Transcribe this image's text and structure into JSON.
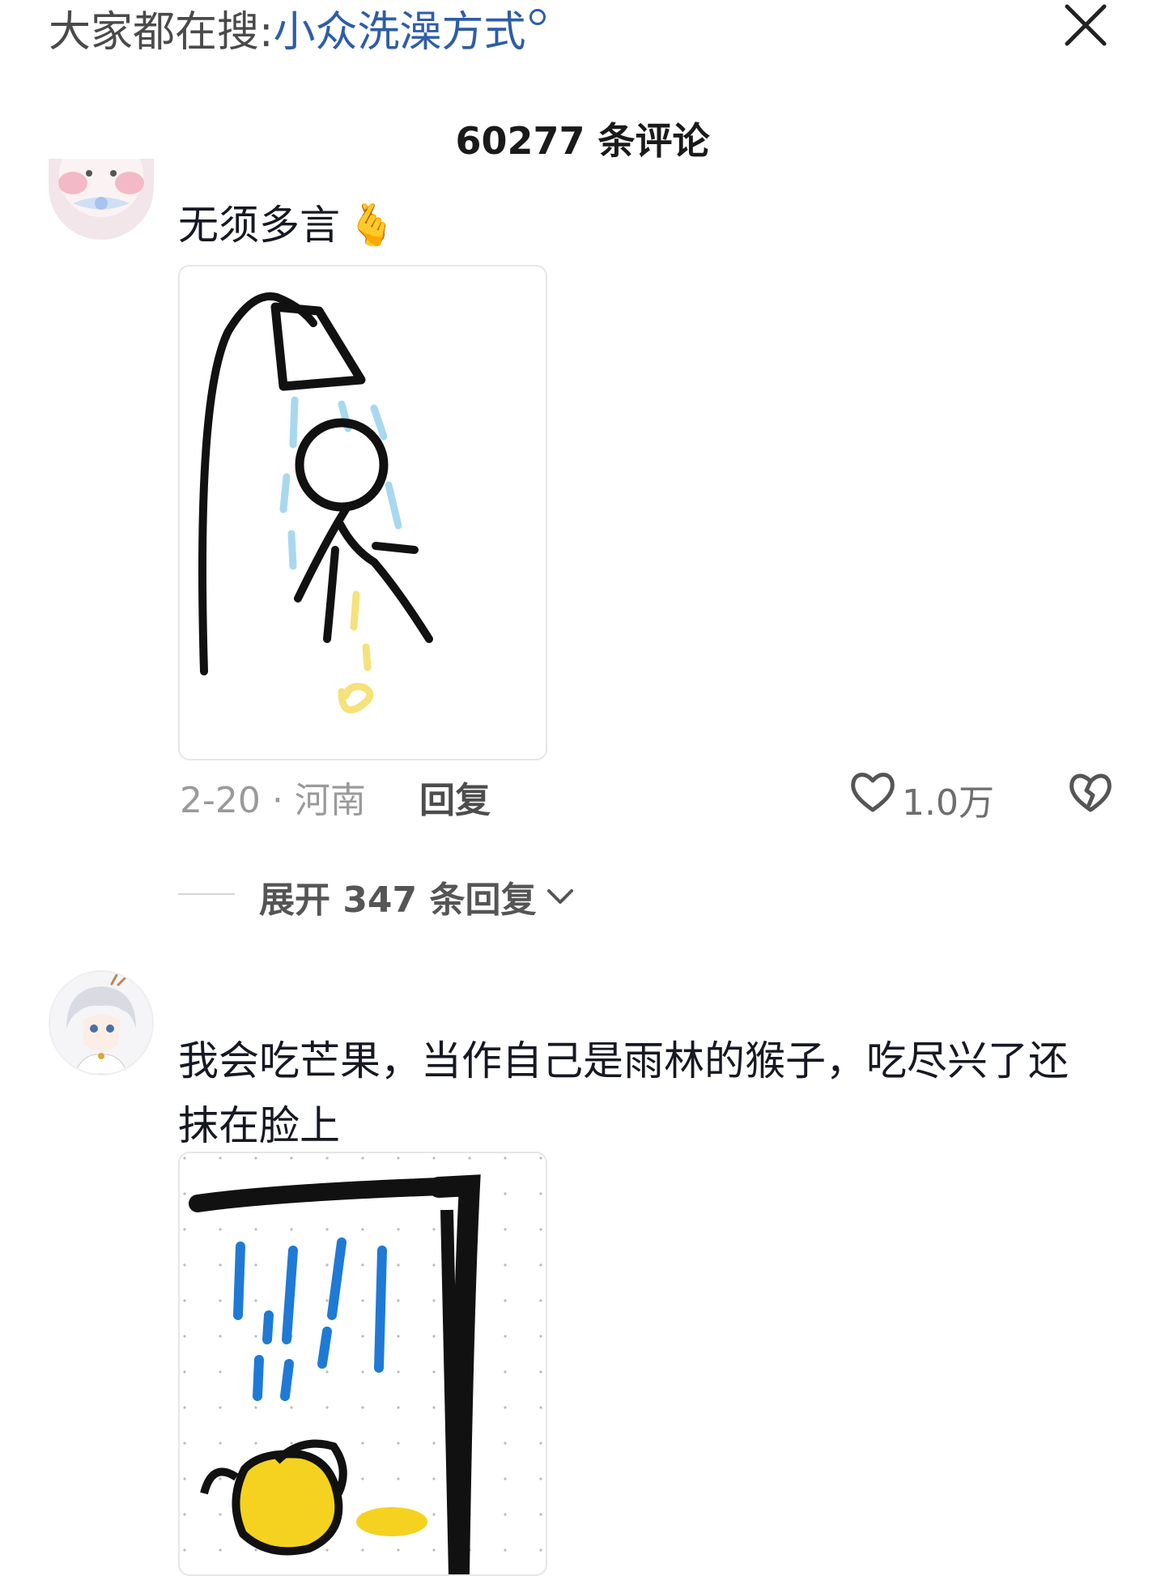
{
  "header": {
    "search_prefix": "大家都在搜:",
    "search_keyword": "小众洗澡方式",
    "search_icon": "search-icon",
    "close_icon": "close-icon"
  },
  "comments_title": "60277 条评论",
  "comments": [
    {
      "text": "无须多言",
      "emoji": "🫰",
      "image_desc_icon": "shower-drawing",
      "date_location": "2-20 · 河南",
      "reply_label": "回复",
      "like_icon": "heart-icon",
      "like_count": "1.0万",
      "dislike_icon": "broken-heart-icon",
      "expand_label": "展开 347 条回复"
    },
    {
      "text": "我会吃芒果，当作自己是雨林的猴子，吃尽兴了还抹在脸上",
      "image_desc_icon": "shower-drawing-2"
    }
  ],
  "colors": {
    "keyword": "#2e5da8",
    "text": "#161823",
    "meta": "#9a9a9a",
    "shower_water": "#a8d8f0",
    "mango": "#f5d21f",
    "water_blue": "#1f7ad6"
  }
}
